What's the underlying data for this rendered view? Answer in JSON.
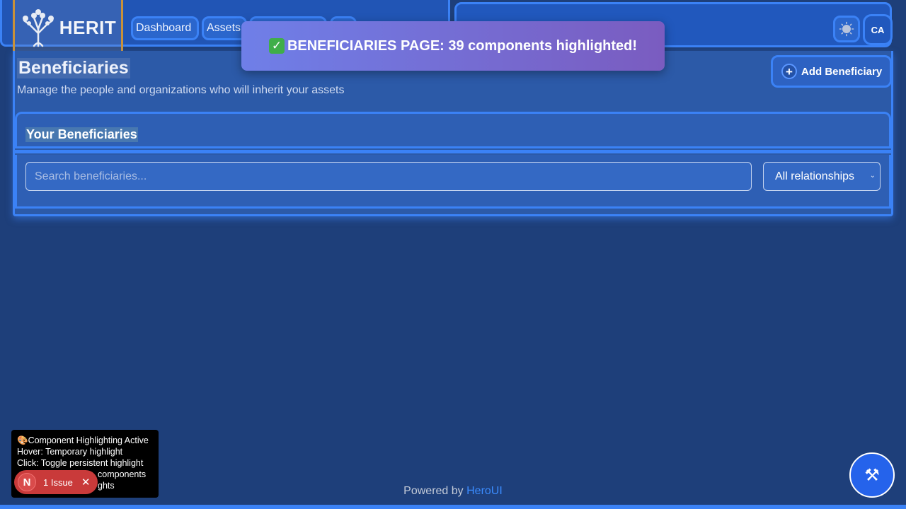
{
  "brand": {
    "logo_text": "HERIT"
  },
  "nav": {
    "links": [
      {
        "label": "Dashboard"
      },
      {
        "label": "Assets"
      },
      {
        "label": ""
      },
      {
        "label": ""
      }
    ],
    "avatar_initials": "CA"
  },
  "toast": {
    "message": "BENEFICIARIES PAGE: 39 components highlighted!"
  },
  "page": {
    "title": "Beneficiaries",
    "subtitle": "Manage the people and organizations who will inherit your assets",
    "add_button_label": "Add Beneficiary"
  },
  "card": {
    "title": "Your Beneficiaries",
    "search_placeholder": "Search beneficiaries...",
    "filter_selected": "All relationships"
  },
  "footer": {
    "prefix": "Powered by",
    "link": "HeroUI"
  },
  "debug": {
    "lines": [
      "Component Highlighting Active",
      "Hover: Temporary highlight",
      "Click: Toggle persistent highlight",
      "components",
      "ghts"
    ]
  },
  "issues": {
    "label": "1 Issue",
    "logo_letter": "N"
  },
  "colors": {
    "accent": "#3b82f6",
    "background": "#1e3f7a",
    "toast_start": "#6f7fe8",
    "toast_end": "#7a5cc0",
    "issue": "#c93a3a"
  }
}
